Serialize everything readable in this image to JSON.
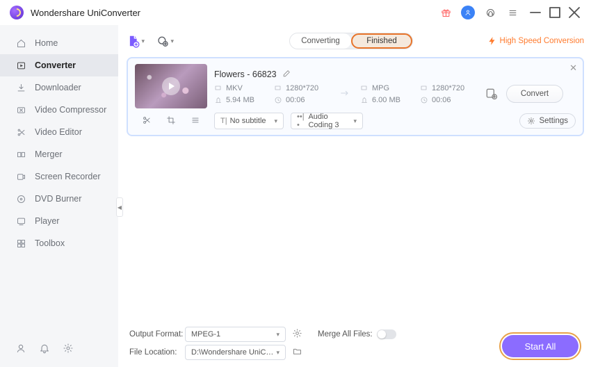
{
  "app_title": "Wondershare UniConverter",
  "sidebar": {
    "items": [
      {
        "label": "Home"
      },
      {
        "label": "Converter"
      },
      {
        "label": "Downloader"
      },
      {
        "label": "Video Compressor"
      },
      {
        "label": "Video Editor"
      },
      {
        "label": "Merger"
      },
      {
        "label": "Screen Recorder"
      },
      {
        "label": "DVD Burner"
      },
      {
        "label": "Player"
      },
      {
        "label": "Toolbox"
      }
    ],
    "active_index": 1
  },
  "tabs": {
    "converting": "Converting",
    "finished": "Finished"
  },
  "speed_label": "High Speed Conversion",
  "item": {
    "filename": "Flowers - 66823",
    "source": {
      "format": "MKV",
      "resolution": "1280*720",
      "size": "5.94 MB",
      "duration": "00:06"
    },
    "target": {
      "format": "MPG",
      "resolution": "1280*720",
      "size": "6.00 MB",
      "duration": "00:06"
    },
    "subtitle_value": "No subtitle",
    "audio_value": "Audio Coding 3",
    "settings_label": "Settings",
    "convert_label": "Convert"
  },
  "footer": {
    "output_format_label": "Output Format:",
    "output_format_value": "MPEG-1",
    "file_location_label": "File Location:",
    "file_location_value": "D:\\Wondershare UniConverter",
    "merge_label": "Merge All Files:",
    "start_all": "Start All"
  }
}
